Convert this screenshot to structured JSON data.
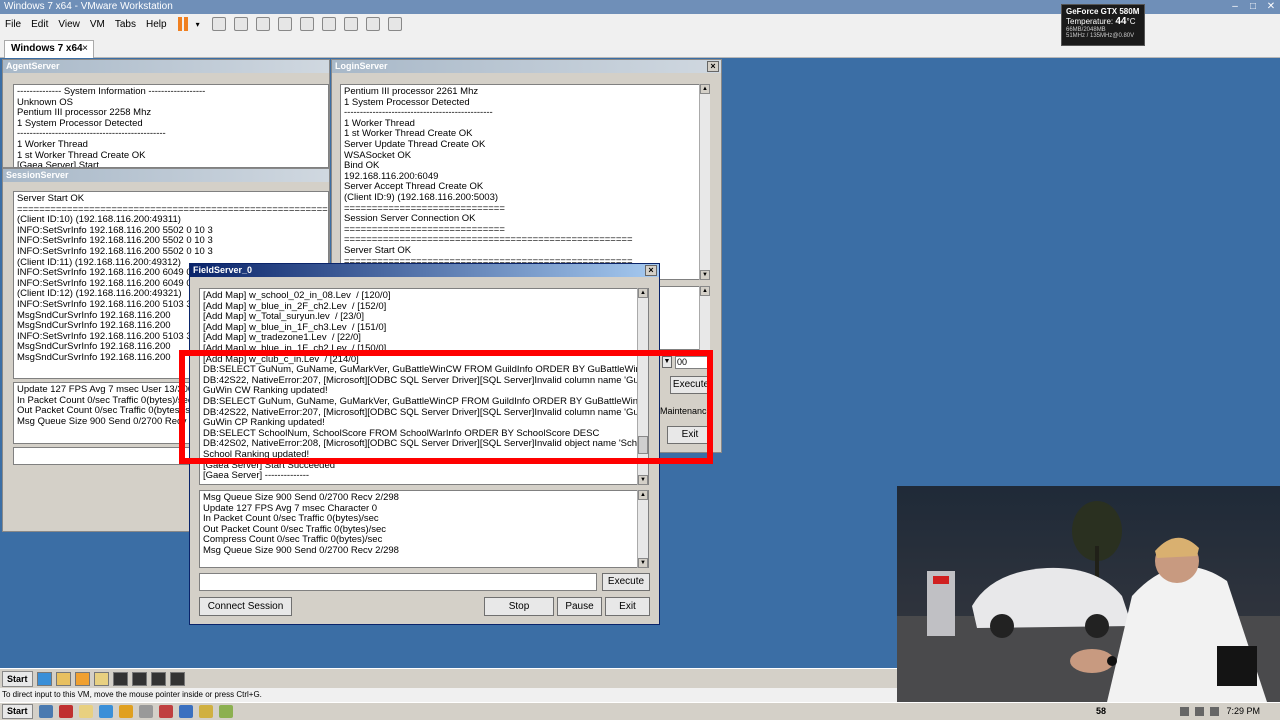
{
  "vmware": {
    "title": "Windows 7 x64 - VMware Workstation",
    "menu": [
      "File",
      "Edit",
      "View",
      "VM",
      "Tabs",
      "Help"
    ],
    "tab_label": "Windows 7 x64",
    "status_hint": "To direct input to this VM, move the mouse pointer inside or press Ctrl+G."
  },
  "gpu": {
    "name": "GeForce GTX 580M",
    "temp_label": "Temperature:",
    "temp_value": "44",
    "temp_unit": "°C",
    "mem": "66MB/2048MB",
    "clock": "51MHz / 135MHz@0.80V"
  },
  "agent_server": {
    "title": "AgentServer",
    "log": "-------------- System Information ------------------\nUnknown OS\nPentium III processor 2258 Mhz\n1 System Processor Detected\n-----------------------------------------------\n1 Worker Thread\n1 st Worker Thread Create OK\n[Gaea Server] Start"
  },
  "session_server": {
    "title": "SessionServer",
    "log": "Server Start OK\n===============================================================\n(Client ID:10) (192.168.116.200:49311)\nINFO:SetSvrInfo 192.168.116.200 5502 0 10 3\nINFO:SetSvrInfo 192.168.116.200 5502 0 10 3\nINFO:SetSvrInfo 192.168.116.200 5502 0 10 3\n(Client ID:11) (192.168.116.200:49312)\nINFO:SetSvrInfo 192.168.116.200 6049 0 0 1\nINFO:SetSvrInfo 192.168.116.200 6049 0 0 1\n(Client ID:12) (192.168.116.200:49321)\nINFO:SetSvrInfo 192.168.116.200 5103 300 0\nMsgSndCurSvrInfo 192.168.116.200\nMsgSndCurSvrInfo 192.168.116.200\nINFO:SetSvrInfo 192.168.116.200 5103 300 0\nMsgSndCurSvrInfo 192.168.116.200\nMsgSndCurSvrInfo 192.168.116.200",
    "stats": "Update 127 FPS Avg 7 msec User 13/300\nIn Packet Count 0/sec Traffic 0(bytes)/sec\nOut Packet Count 0/sec Traffic 0(bytes)/sec\nMsg Queue Size 900 Send 0/2700 Recv 3/"
  },
  "login_server": {
    "title": "LoginServer",
    "log": "Pentium III processor 2261 Mhz\n1 System Processor Detected\n-----------------------------------------------\n1 Worker Thread\n1 st Worker Thread Create OK\nServer Update Thread Create OK\nWSASocket OK\nBind OK\n192.168.116.200:6049\nServer Accept Thread Create OK\n(Client ID:9) (192.168.116.200:5003)\n=============================\nSession Server Connection OK\n=============================\n====================================================\nServer Start OK\n====================================================",
    "combo_value": "00",
    "execute_label": "Execute",
    "maintenance_label": "Maintenanc",
    "exit_label": "Exit"
  },
  "field_server": {
    "title": "FieldServer_0",
    "log": "[Add Map] w_school_02_in_08.Lev  / [120/0]\n[Add Map] w_blue_in_2F_ch2.Lev  / [152/0]\n[Add Map] w_Total_suryun.lev  / [23/0]\n[Add Map] w_blue_in_1F_ch3.Lev  / [151/0]\n[Add Map] w_tradezone1.Lev  / [22/0]\n[Add Map] w_blue_in_1F_ch2.Lev  / [150/0]\n[Add Map] w_club_c_in.Lev  / [214/0]\nDB:SELECT GuNum, GuName, GuMarkVer, GuBattleWinCW FROM GuildInfo ORDER BY GuBattleWinCW DESC\nDB:42S22, NativeError:207, [Microsoft][ODBC SQL Server Driver][SQL Server]Invalid column name 'GuBattleWinCW'\nGuWin CW Ranking updated!\nDB:SELECT GuNum, GuName, GuMarkVer, GuBattleWinCP FROM GuildInfo ORDER BY GuBattleWinCP DESC\nDB:42S22, NativeError:207, [Microsoft][ODBC SQL Server Driver][SQL Server]Invalid column name 'GuBattleWinCP'\nGuWin CP Ranking updated!\nDB:SELECT SchoolNum, SchoolScore FROM SchoolWarInfo ORDER BY SchoolScore DESC\nDB:42S02, NativeError:208, [Microsoft][ODBC SQL Server Driver][SQL Server]Invalid object name 'SchoolWarInfo'\nSchool Ranking updated!\n[Gaea Server] Start Succeeded\n[Gaea Server] --------------",
    "stats": "Msg Queue Size 900 Send 0/2700 Recv 2/298\nUpdate 127 FPS Avg 7 msec Character 0\nIn Packet Count 0/sec Traffic 0(bytes)/sec\nOut Packet Count 0/sec Traffic 0(bytes)/sec\nCompress Count 0/sec Traffic 0(bytes)/sec\nMsg Queue Size 900 Send 0/2700 Recv 2/298",
    "execute_label": "Execute",
    "connect_label": "Connect Session",
    "stop_label": "Stop",
    "pause_label": "Pause",
    "exit_label": "Exit"
  },
  "guest_taskbar": {
    "start_label": "Start"
  },
  "host_taskbar": {
    "start_label": "Start",
    "count": "58",
    "clock": "7:29 PM"
  },
  "colors": {
    "desktop": "#3b6ea5",
    "highlight": "#ff0000",
    "title_active": "#0a246a"
  }
}
